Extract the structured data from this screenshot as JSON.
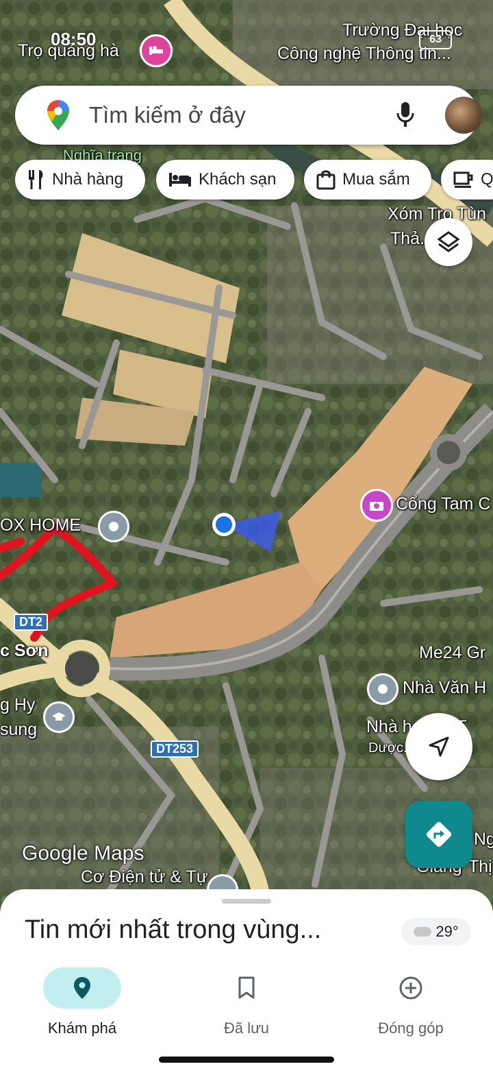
{
  "status_bar": {
    "time": "08:50",
    "battery": "63"
  },
  "search": {
    "placeholder": "Tìm kiếm ở đây"
  },
  "chips": [
    {
      "label": "Nhà hàng",
      "icon": "restaurant-icon"
    },
    {
      "label": "Khách sạn",
      "icon": "hotel-icon"
    },
    {
      "label": "Mua sắm",
      "icon": "shopping-bag-icon"
    },
    {
      "label": "Q",
      "icon": "coffee-icon"
    }
  ],
  "map_labels": {
    "tro_quang_ha": "Trọ quảng hà",
    "truong_dh_1": "Trường Đại học",
    "truong_dh_2": "Công nghệ Thông tin...",
    "nghia_trang": "Nghĩa trang",
    "xom_tro_1": "Xóm Trọ Tùn",
    "xom_tro_2": "Thả... yê",
    "cong_tam": "Cổng Tam C",
    "ox_home": "OX HOME",
    "c_son": "c Sơn",
    "me24": "Me24 Gr",
    "nha_van_h": "Nhà Văn H",
    "nha_h": "Nhà h... ơn T",
    "duoc": "Dược... ca",
    "g_hy": "g Hy",
    "sung": "sung",
    "co_dien_tu": "Cơ Điện tử & Tự",
    "nghi": "Ng",
    "giang": "Giang",
    "thi": "Thị"
  },
  "road_badges": {
    "dt_left": "DT2",
    "dt253": "DT253"
  },
  "branding": {
    "google": "Google",
    "maps": "Maps"
  },
  "sheet": {
    "title": "Tin mới nhất trong vùng...",
    "weather": "29°"
  },
  "bottom_nav": [
    {
      "label": "Khám phá",
      "active": true
    },
    {
      "label": "Đã lưu",
      "active": false
    },
    {
      "label": "Đóng góp",
      "active": false
    }
  ],
  "colors": {
    "accent": "#0e7a7e",
    "nav_active_bg": "#c2eef0",
    "location_dot": "#1a73e8",
    "annotation": "#e0141e"
  }
}
